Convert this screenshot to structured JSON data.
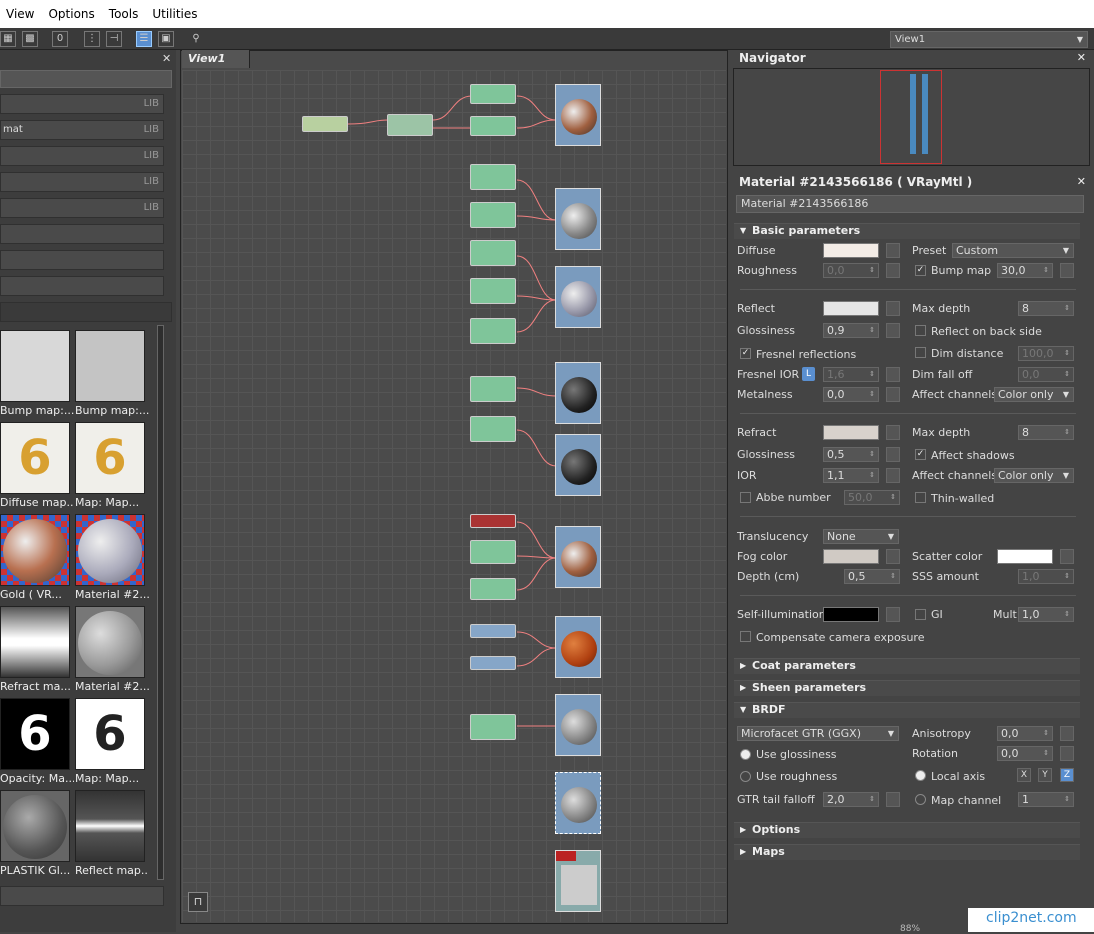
{
  "menu": [
    "View",
    "Options",
    "Tools",
    "Utilities"
  ],
  "toolbar": {
    "view_select": "View1"
  },
  "left_panel": {
    "rows": [
      {
        "label": "",
        "lib": "LIB"
      },
      {
        "label": "mat",
        "lib": "LIB"
      },
      {
        "label": "",
        "lib": "LIB"
      },
      {
        "label": "",
        "lib": "LIB"
      },
      {
        "label": "",
        "lib": "LIB"
      }
    ],
    "thumbnails": [
      "Bump map:...",
      "Bump map:...",
      "Diffuse map...",
      "Map: Map...",
      "Gold  ( VR...",
      "Material #2...",
      "Refract ma...",
      "Material #2...",
      "Opacity: Ma...",
      "Map: Map...",
      "PLASTIK Gl...",
      "Reflect map..."
    ]
  },
  "view": {
    "tab": "View1"
  },
  "navigator": {
    "title": "Navigator"
  },
  "material": {
    "title": "Material #2143566186  ( VRayMtl )",
    "name": "Material #2143566186",
    "basic": {
      "header": "Basic parameters",
      "diffuse": "Diffuse",
      "preset_label": "Preset",
      "preset": "Custom",
      "roughness": "Roughness",
      "roughness_val": "0,0",
      "bump_label": "Bump map",
      "bump_val": "30,0",
      "reflect": "Reflect",
      "maxdepth": "Max depth",
      "maxdepth_val": "8",
      "glossiness": "Glossiness",
      "gloss_val": "0,9",
      "reflect_back": "Reflect on back side",
      "fresnel": "Fresnel reflections",
      "dim_distance": "Dim distance",
      "dim_distance_val": "100,0",
      "fresnel_ior": "Fresnel IOR",
      "l_btn": "L",
      "fresnel_ior_val": "1,6",
      "dim_falloff": "Dim fall off",
      "dim_falloff_val": "0,0",
      "metalness": "Metalness",
      "metalness_val": "0,0",
      "affect_channels": "Affect channels",
      "affect_val": "Color only",
      "refract": "Refract",
      "r_maxdepth": "Max depth",
      "r_maxdepth_val": "8",
      "r_gloss": "Glossiness",
      "r_gloss_val": "0,5",
      "affect_shadows": "Affect shadows",
      "ior": "IOR",
      "ior_val": "1,1",
      "r_affect_channels": "Affect channels",
      "r_affect_val": "Color only",
      "abbe": "Abbe number",
      "abbe_val": "50,0",
      "thin_walled": "Thin-walled",
      "translucency": "Translucency",
      "translucency_val": "None",
      "fog_color": "Fog color",
      "scatter_color": "Scatter color",
      "depth": "Depth (cm)",
      "depth_val": "0,5",
      "sss": "SSS amount",
      "sss_val": "1,0",
      "self_illum": "Self-illumination",
      "gi": "GI",
      "mult": "Mult",
      "mult_val": "1,0",
      "comp_cam": "Compensate camera exposure"
    },
    "sections": {
      "coat": "Coat parameters",
      "sheen": "Sheen parameters",
      "brdf": "BRDF",
      "options": "Options",
      "maps": "Maps"
    },
    "brdf": {
      "type": "Microfacet GTR (GGX)",
      "anisotropy": "Anisotropy",
      "anisotropy_val": "0,0",
      "use_gloss": "Use glossiness",
      "rotation": "Rotation",
      "rotation_val": "0,0",
      "use_rough": "Use roughness",
      "local_axis": "Local axis",
      "ax_x": "X",
      "ax_y": "Y",
      "ax_z": "Z",
      "gtr": "GTR tail falloff",
      "gtr_val": "2,0",
      "map_channel": "Map channel",
      "map_channel_val": "1"
    }
  },
  "colors": {
    "diffuse": "#f3ece6",
    "reflect": "#e6e6e6",
    "refract": "#d8d2cc",
    "fog": "#d0cac4",
    "scatter": "#ffffff",
    "self_illum": "#000000",
    "accent": "#5a8fd0"
  },
  "watermark": "clip2net.com",
  "status": "88%"
}
